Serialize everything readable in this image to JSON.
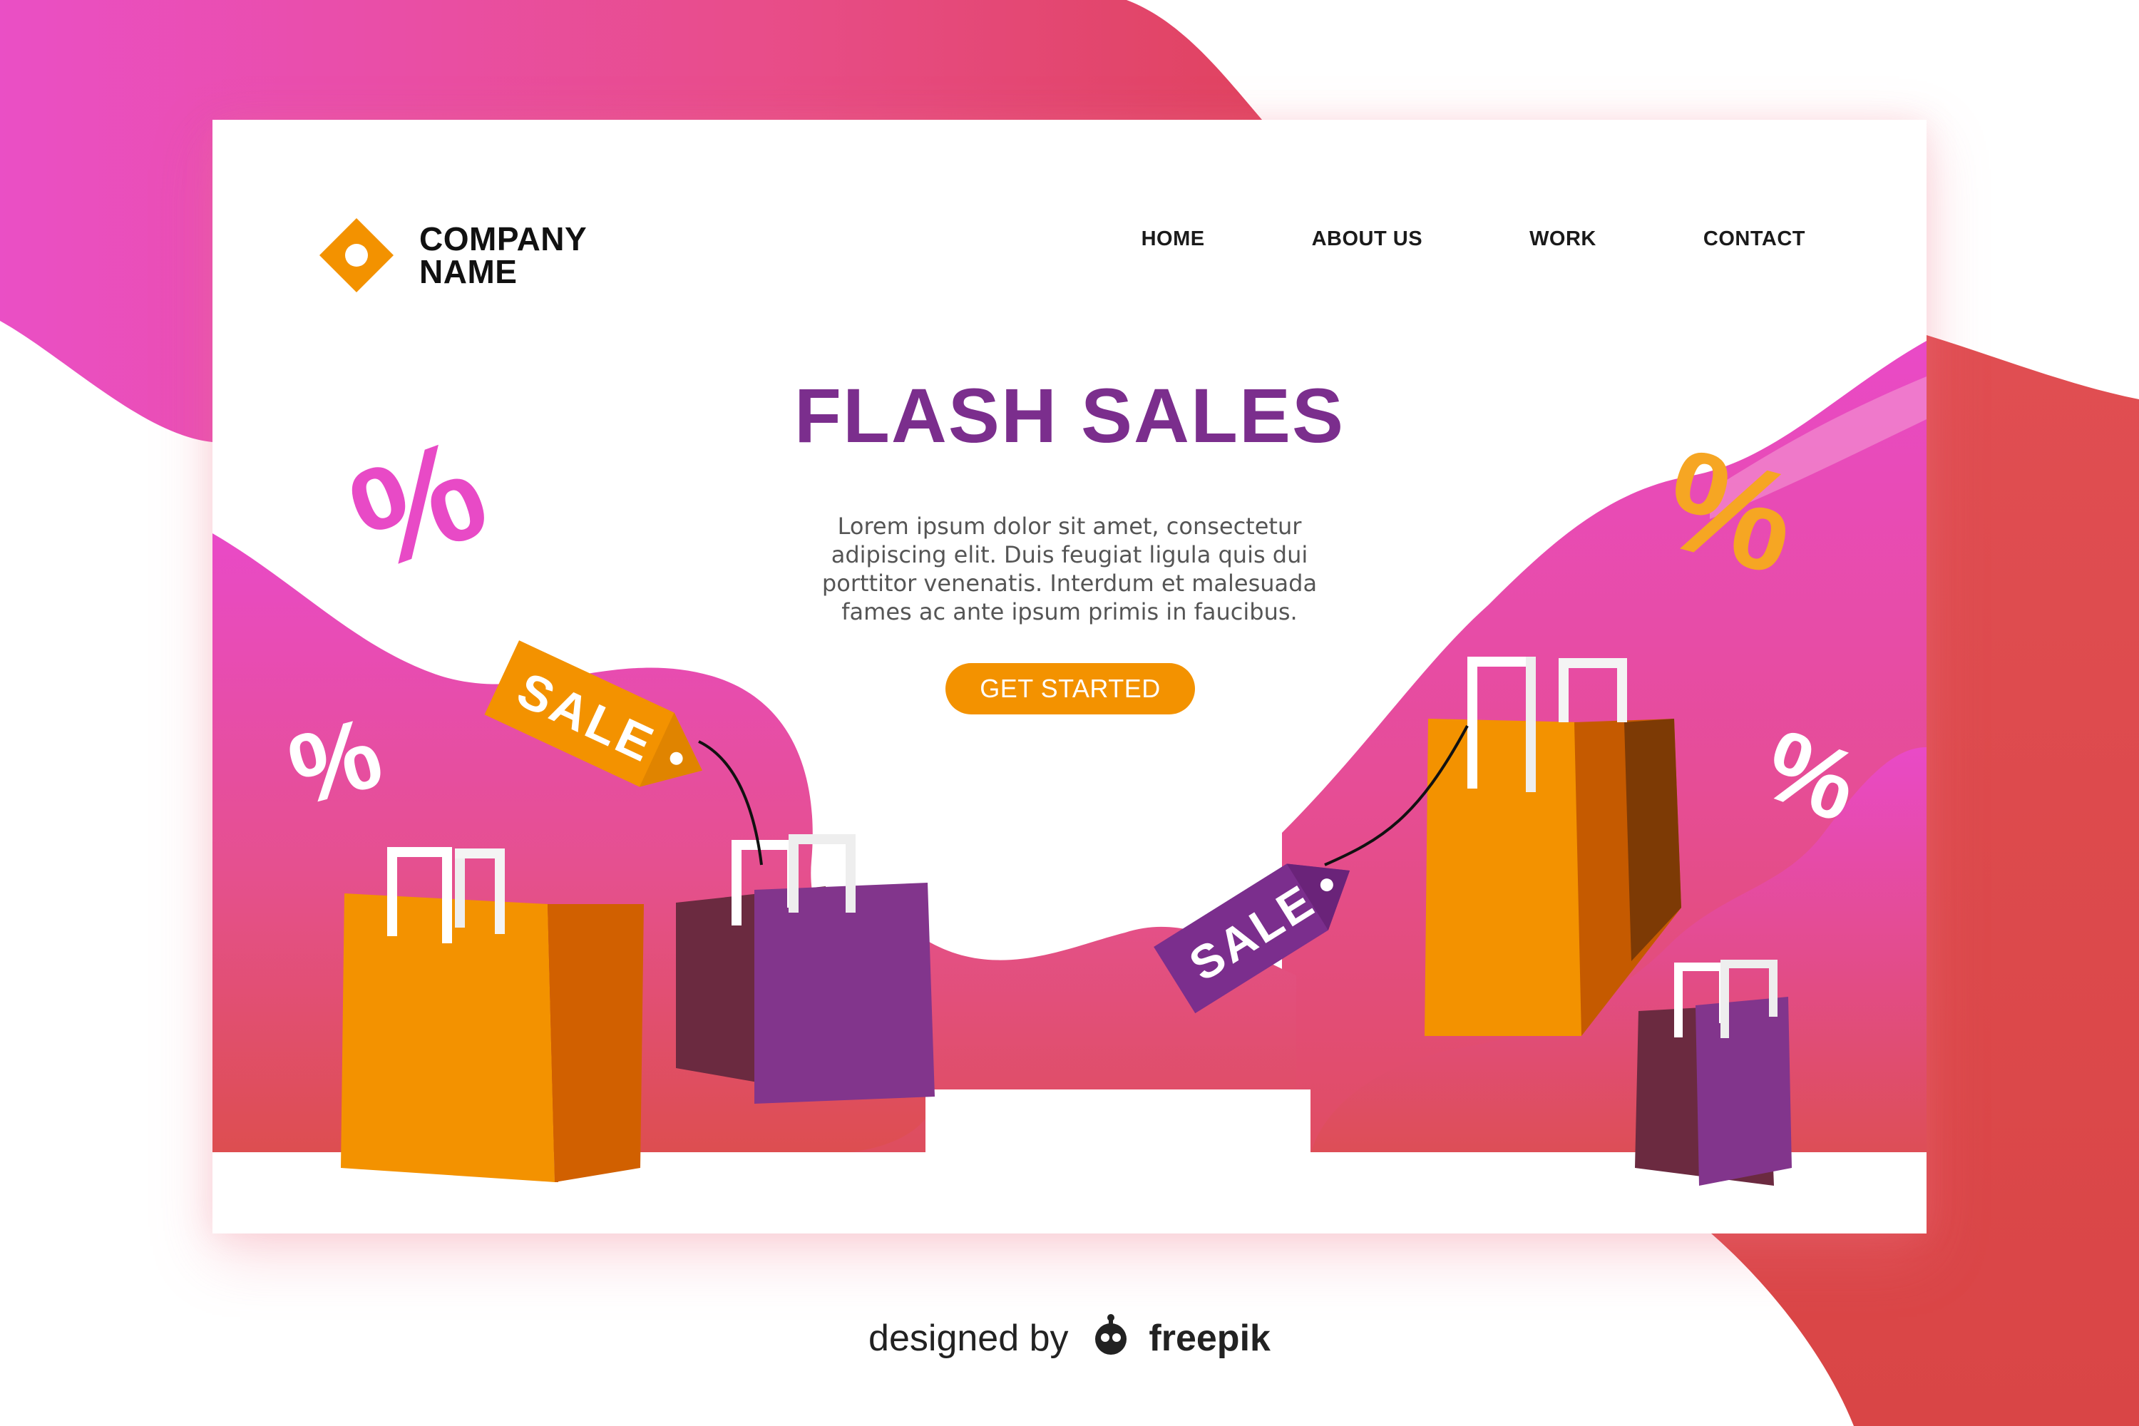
{
  "brand": {
    "name_line1": "COMPANY",
    "name_line2": "NAME"
  },
  "nav": {
    "items": [
      {
        "label": "HOME"
      },
      {
        "label": "ABOUT US"
      },
      {
        "label": "WORK"
      },
      {
        "label": "CONTACT"
      }
    ]
  },
  "hero": {
    "title": "FLASH SALES",
    "body": "Lorem ipsum dolor sit amet, consectetur adipiscing elit. Duis feugiat ligula quis dui porttitor venenatis. Interdum et malesuada fames ac ante ipsum primis in faucibus.",
    "cta_label": "GET STARTED"
  },
  "decor": {
    "percent_symbol": "%",
    "tag_text": "SALE"
  },
  "credit": {
    "prefix": "designed by",
    "brand": "freepik"
  },
  "colors": {
    "primary_purple": "#7b2e8d",
    "accent_orange": "#f39200",
    "pink": "#e84ac6",
    "coral": "#df4f52"
  }
}
